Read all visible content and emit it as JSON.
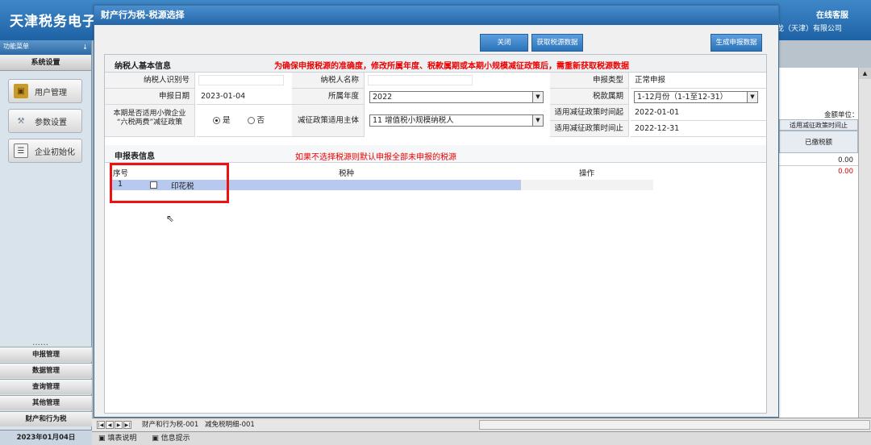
{
  "app": {
    "title": "天津税务电子申",
    "online_service": "在线客服",
    "company_name": "长龙（天津）有限公司"
  },
  "sidebar": {
    "func_menu_label": "功能菜单",
    "pin_label": "↓",
    "system_settings": "系统设置",
    "buttons": [
      {
        "label": "用户管理",
        "icon": "user-management-icon"
      },
      {
        "label": "参数设置",
        "icon": "wrench-icon"
      },
      {
        "label": "企业初始化",
        "icon": "company-init-icon"
      }
    ],
    "separator": "……",
    "nav_items": [
      "申报管理",
      "数据管理",
      "查询管理",
      "其他管理",
      "财产和行为税"
    ],
    "date": "2023年01月04日"
  },
  "background_panel": {
    "unit_label": "金额单位：人",
    "header_policy_end": "适用减征政策时间止",
    "header_paid_tax": "已缴税额",
    "value_1": "0.00",
    "value_2": "0.00"
  },
  "dialog": {
    "title": "财产行为税-税源选择",
    "buttons": {
      "close": "关闭",
      "fetch_tax_source": "获取税源数据",
      "generate_report": "生成申报数据"
    },
    "basic_info": {
      "section_title": "纳税人基本信息",
      "warning": "为确保申报税源的准确度，修改所属年度、税款属期或本期小规模减征政策后，需重新获取税源数据",
      "taxpayer_id_label": "纳税人识别号",
      "taxpayer_name_label": "纳税人名称",
      "report_type_label": "申报类型",
      "report_type_value": "正常申报",
      "report_date_label": "申报日期",
      "report_date_value": "2023-01-04",
      "year_label": "所属年度",
      "year_value": "2022",
      "tax_period_label": "税款属期",
      "tax_period_value": "1-12月份（1-1至12-31）",
      "policy_question_line1": "本期是否适用小微企业",
      "policy_question_line2": "“六税两费”减征政策",
      "radio_yes": "是",
      "radio_no": "否",
      "radio_selected": "yes",
      "reduction_subject_label": "减征政策适用主体",
      "reduction_subject_value": "11  增值税小规模纳税人",
      "policy_start_label": "适用减征政策时间起",
      "policy_start_value": "2022-01-01",
      "policy_end_label": "适用减征政策时间止",
      "policy_end_value": "2022-12-31"
    },
    "report_info": {
      "section_title": "申报表信息",
      "hint": "如果不选择税源则默认申报全部未申报的税源",
      "columns": {
        "seq": "序号",
        "tax_type": "税种",
        "operation": "操作"
      },
      "rows": [
        {
          "seq": "1",
          "tax_type": "印花税",
          "checked": false
        }
      ]
    }
  },
  "sheet_tabs": [
    "财产和行为税-001",
    "减免税明细-001"
  ],
  "status_bar": [
    "填表说明",
    "信息提示"
  ],
  "colors": {
    "title_blue": "#2466a8",
    "warning_red": "#e00000",
    "selected_row": "#b7c9ee",
    "highlight_box": "#e11111"
  }
}
